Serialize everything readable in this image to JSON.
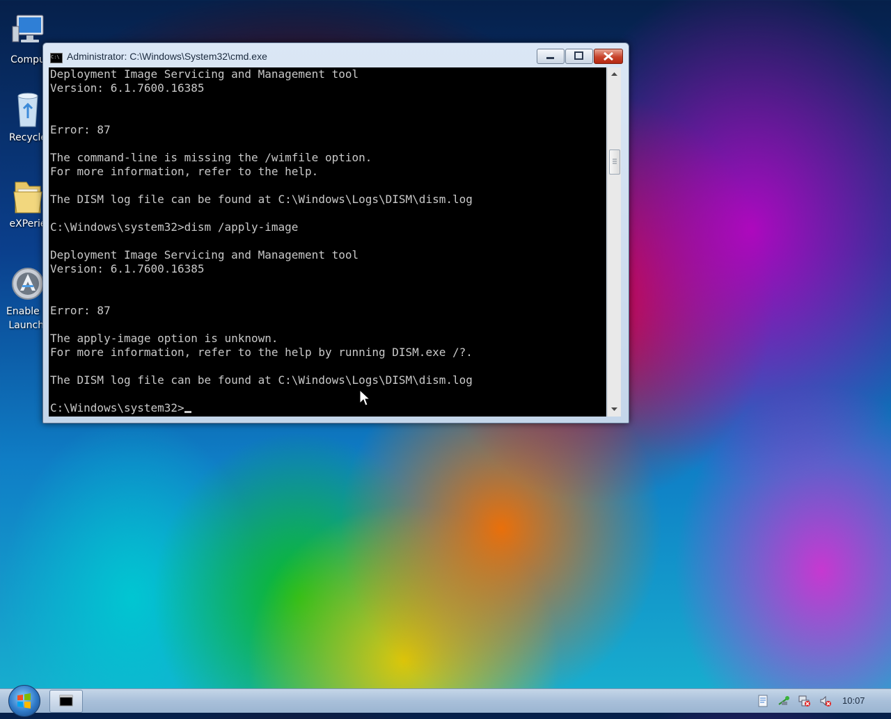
{
  "desktop": {
    "icons": [
      {
        "label": "Compu",
        "name": "computer",
        "icon": "computer-icon"
      },
      {
        "label": "Recycle",
        "name": "recycle-bin",
        "icon": "recycle-bin-icon"
      },
      {
        "label": "eXPerie",
        "name": "experience-folder",
        "icon": "folder-icon"
      },
      {
        "label": "Enable C",
        "label2": "Launch.",
        "name": "launcher",
        "icon": "launcher-icon"
      }
    ]
  },
  "window": {
    "title": "Administrator: C:\\Windows\\System32\\cmd.exe",
    "icon": "cmd-icon",
    "buttons": {
      "minimize": "minimize-icon",
      "maximize": "maximize-icon",
      "close": "close-icon"
    }
  },
  "console": {
    "lines": [
      "Deployment Image Servicing and Management tool",
      "Version: 6.1.7600.16385",
      "",
      "",
      "Error: 87",
      "",
      "The command-line is missing the /wimfile option.",
      "For more information, refer to the help.",
      "",
      "The DISM log file can be found at C:\\Windows\\Logs\\DISM\\dism.log",
      "",
      "C:\\Windows\\system32>dism /apply-image",
      "",
      "Deployment Image Servicing and Management tool",
      "Version: 6.1.7600.16385",
      "",
      "",
      "Error: 87",
      "",
      "The apply-image option is unknown.",
      "For more information, refer to the help by running DISM.exe /?.",
      "",
      "The DISM log file can be found at C:\\Windows\\Logs\\DISM\\dism.log",
      ""
    ],
    "prompt": "C:\\Windows\\system32>"
  },
  "taskbar": {
    "start_icon": "windows-start-icon",
    "pinned": "cmd-taskbar-icon",
    "tray": [
      "notes-icon",
      "network-icon",
      "network-disconnected-icon",
      "volume-muted-icon"
    ],
    "clock": "10:07"
  }
}
